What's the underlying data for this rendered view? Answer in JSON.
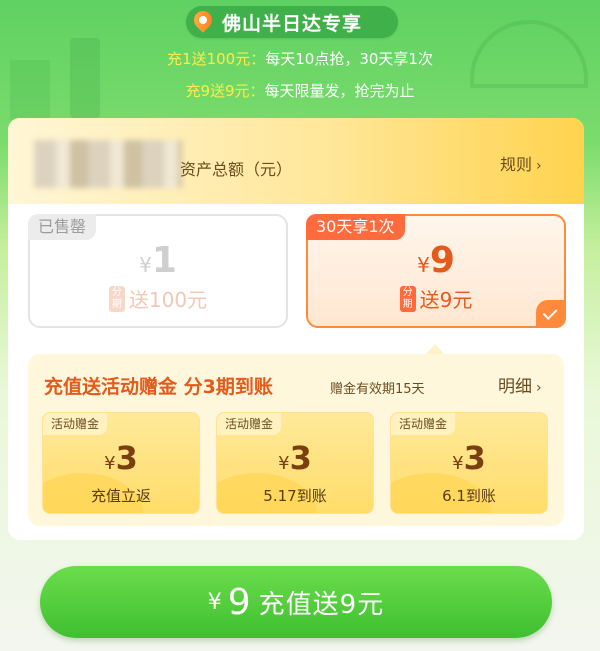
{
  "header": {
    "location_label": "佛山半日达专享",
    "promo_line1": {
      "highlight": "充1送100元：",
      "rest": "每天10点抢，30天享1次"
    },
    "promo_line2": {
      "highlight": "充9送9元：",
      "rest": "每天限量发，抢完为止"
    }
  },
  "assets": {
    "label": "资产总额（元）",
    "rule_link": "规则"
  },
  "options": [
    {
      "tag": "已售罄",
      "currency": "¥",
      "amount": "1",
      "installment_badge": "分期",
      "gift": "送100元",
      "status": "sold-out"
    },
    {
      "tag": "30天享1次",
      "currency": "¥",
      "amount": "9",
      "installment_badge": "分期",
      "gift": "送9元",
      "status": "selected"
    }
  ],
  "bonus": {
    "title": "充值送活动赠金 分3期到账",
    "validity": "赠金有效期15天",
    "detail_link": "明细",
    "items": [
      {
        "tag": "活动赠金",
        "currency": "¥",
        "amount": "3",
        "note": "充值立返"
      },
      {
        "tag": "活动赠金",
        "currency": "¥",
        "amount": "3",
        "note": "5.17到账"
      },
      {
        "tag": "活动赠金",
        "currency": "¥",
        "amount": "3",
        "note": "6.1到账"
      }
    ]
  },
  "cta": {
    "currency": "¥",
    "amount": "9",
    "label": "充值送9元"
  },
  "colors": {
    "primary_green": "#3fbf31",
    "accent_orange": "#ff6b3d",
    "gold": "#ffdd6a"
  },
  "icons": {
    "location": "location-pin-icon",
    "chevron": "chevron-right-icon",
    "check": "check-icon"
  }
}
